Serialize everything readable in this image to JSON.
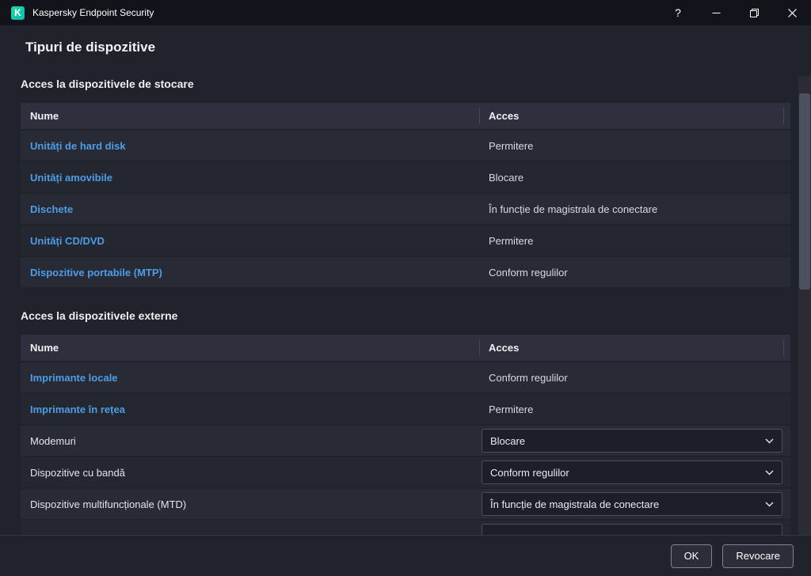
{
  "window": {
    "title": "Kaspersky Endpoint Security",
    "logo": "K",
    "controls": {
      "help": "?"
    }
  },
  "page": {
    "title": "Tipuri de dispozitive"
  },
  "sections": [
    {
      "heading": "Acces la dispozitivele de stocare",
      "columns": [
        "Nume",
        "Acces"
      ],
      "rows": [
        {
          "name": "Unități de hard disk",
          "control": "link",
          "access": "Permitere"
        },
        {
          "name": "Unități amovibile",
          "control": "link",
          "access": "Blocare"
        },
        {
          "name": "Dischete",
          "control": "link",
          "access": "În funcție de magistrala de conectare"
        },
        {
          "name": "Unități CD/DVD",
          "control": "link",
          "access": "Permitere"
        },
        {
          "name": "Dispozitive portabile (MTP)",
          "control": "link",
          "access": "Conform regulilor"
        }
      ],
      "clipped_next_row": false
    },
    {
      "heading": "Acces la dispozitivele externe",
      "columns": [
        "Nume",
        "Acces"
      ],
      "rows": [
        {
          "name": "Imprimante locale",
          "control": "link",
          "access": "Conform regulilor"
        },
        {
          "name": "Imprimante în rețea",
          "control": "link",
          "access": "Permitere"
        },
        {
          "name": "Modemuri",
          "control": "select",
          "access": "Blocare"
        },
        {
          "name": "Dispozitive cu bandă",
          "control": "select",
          "access": "Conform regulilor"
        },
        {
          "name": "Dispozitive multifuncționale (MTD)",
          "control": "select",
          "access": "În funcție de magistrala de conectare"
        }
      ],
      "clipped_next_row": true
    }
  ],
  "footer": {
    "ok_label": "OK",
    "cancel_label": "Revocare"
  },
  "colors": {
    "link": "#4e9de6",
    "logo_green": "#1ed9a0",
    "background": "#20222c",
    "titlebar": "#12131b",
    "row_odd": "#282a36",
    "row_even": "#242630",
    "table_header": "#2e303e"
  }
}
